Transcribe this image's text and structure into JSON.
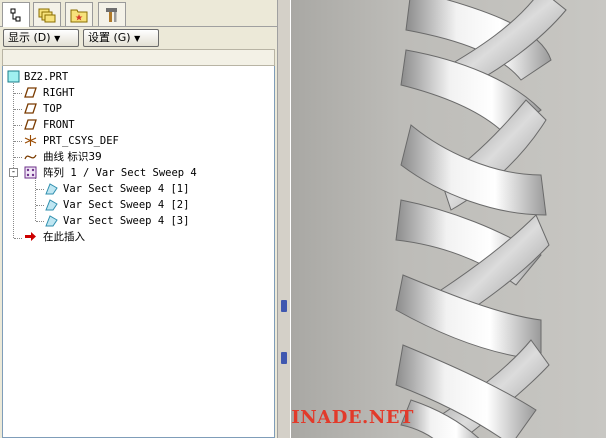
{
  "navigator": {
    "tabs": [
      {
        "icon": "model-tree-icon"
      },
      {
        "icon": "layers-folder-icon"
      },
      {
        "icon": "favorites-folder-icon"
      },
      {
        "icon": "tools-icon"
      }
    ],
    "display_menu": "显示 (D)",
    "settings_menu": "设置 (G)"
  },
  "tree": {
    "root": "BZ2.PRT",
    "items": [
      {
        "label": "RIGHT",
        "icon": "datum-plane-icon"
      },
      {
        "label": "TOP",
        "icon": "datum-plane-icon"
      },
      {
        "label": "FRONT",
        "icon": "datum-plane-icon"
      },
      {
        "label": "PRT_CSYS_DEF",
        "icon": "csys-icon"
      },
      {
        "label": "曲线 标识39",
        "icon": "curve-icon"
      },
      {
        "label": "阵列 1 / Var Sect Sweep 4",
        "icon": "pattern-icon"
      },
      {
        "label": "Var Sect Sweep 4 [1]",
        "icon": "sweep-feature-icon"
      },
      {
        "label": "Var Sect Sweep 4 [2]",
        "icon": "sweep-feature-icon"
      },
      {
        "label": "Var Sect Sweep 4 [3]",
        "icon": "sweep-feature-icon"
      },
      {
        "label": "在此插入",
        "icon": "insert-here-icon"
      }
    ]
  },
  "watermark": "BBS.CHINADE.NET",
  "colors": {
    "insert_arrow": "#cc0000",
    "sweep_icon": "#2f8fae",
    "pattern_icon": "#6d2f8a",
    "watermark": "#e23a2a"
  }
}
